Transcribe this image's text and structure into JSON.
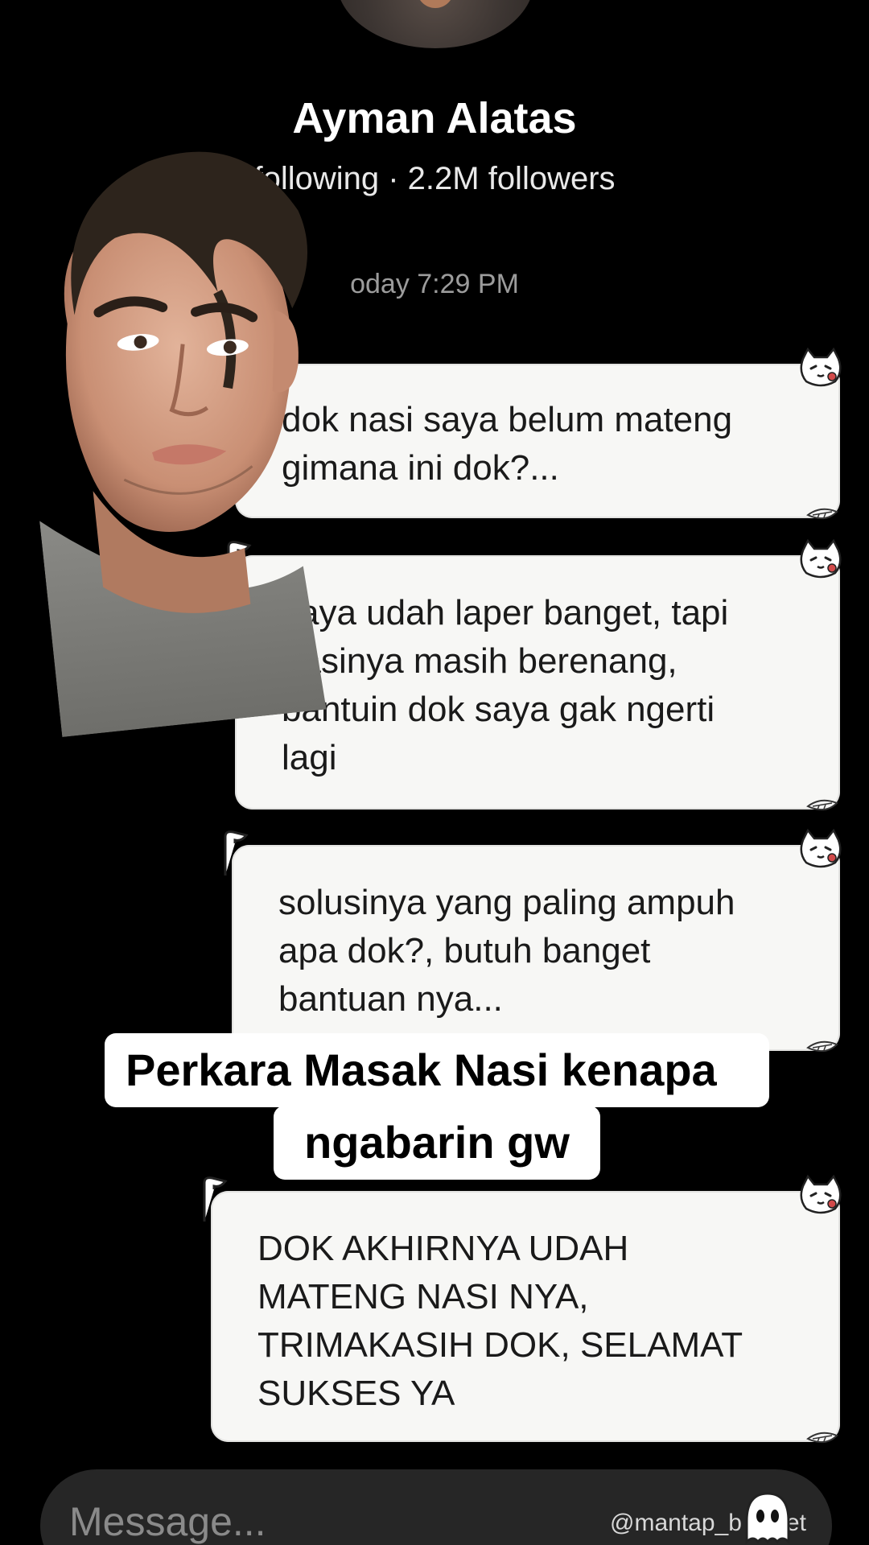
{
  "profile": {
    "name": "Ayman Alatas",
    "stats": "following · 2.2M followers"
  },
  "timestamp": "oday 7:29 PM",
  "messages": [
    {
      "text": "dok nasi saya belum mateng\ngimana ini dok?..."
    },
    {
      "text": "saya udah laper banget, tapi\nnasinya masih berenang,\nbantuin dok saya gak ngerti\nlagi"
    },
    {
      "text": "solusinya yang paling ampuh\napa dok?, butuh banget\nbantuan nya..."
    },
    {
      "text": "DOK AKHIRNYA UDAH\nMATENG NASI NYA,\nTRIMAKASIH DOK, SELAMAT\nSUKSES YA"
    }
  ],
  "caption": {
    "line1": "Perkara Masak Nasi kenapa",
    "line2": "ngabarin gw"
  },
  "input": {
    "placeholder": "Message..."
  },
  "watermark": "@mantap_b    usyet",
  "icons": [
    "cat-sticker-icon",
    "scroll-curl-icon",
    "leaf-icon",
    "ghost-icon"
  ],
  "colors": {
    "background": "#000000",
    "bubble": "#f7f7f5",
    "caption_bg": "#ffffff",
    "input_bg": "#262626"
  }
}
